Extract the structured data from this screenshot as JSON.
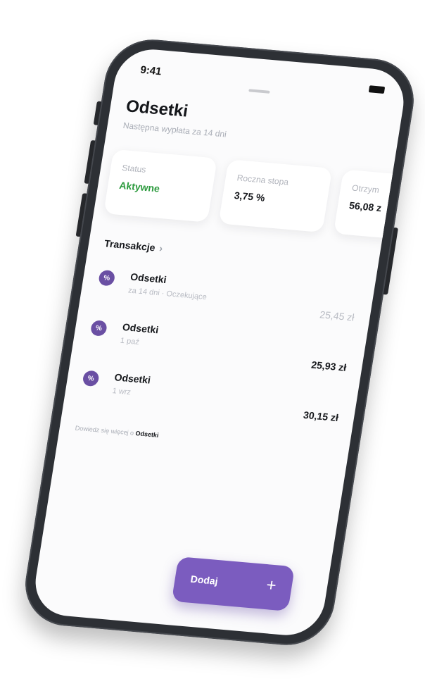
{
  "status_bar": {
    "time": "9:41"
  },
  "header": {
    "title": "Odsetki",
    "subtitle": "Następna wypłata za 14 dni"
  },
  "cards": [
    {
      "label": "Status",
      "value": "Aktywne",
      "value_color": "#2b9a3d"
    },
    {
      "label": "Roczna stopa",
      "value": "3,75 %"
    },
    {
      "label": "Otrzym",
      "value": "56,08 z"
    }
  ],
  "transactions": {
    "heading": "Transakcje",
    "chevron": "›",
    "items": [
      {
        "icon": "percent-icon",
        "icon_text": "%",
        "title": "Odsetki",
        "subtitle": "za 14 dni · Oczekujące",
        "amount": "25,45 zł",
        "pending": true
      },
      {
        "icon": "percent-icon",
        "icon_text": "%",
        "title": "Odsetki",
        "subtitle": "1 paź",
        "amount": "25,93 zł",
        "pending": false
      },
      {
        "icon": "percent-icon",
        "icon_text": "%",
        "title": "Odsetki",
        "subtitle": "1 wrz",
        "amount": "30,15 zł",
        "pending": false
      }
    ]
  },
  "learn_more": {
    "prefix": "Dowiedz się więcej o ",
    "link": "Odsetki"
  },
  "fab": {
    "label": "Dodaj",
    "icon": "plus-icon",
    "icon_text": "+"
  },
  "colors": {
    "accent": "#7b5cbf",
    "icon_bg": "#6a4fa3",
    "status_green": "#2b9a3d",
    "frame": "#2d3035"
  }
}
